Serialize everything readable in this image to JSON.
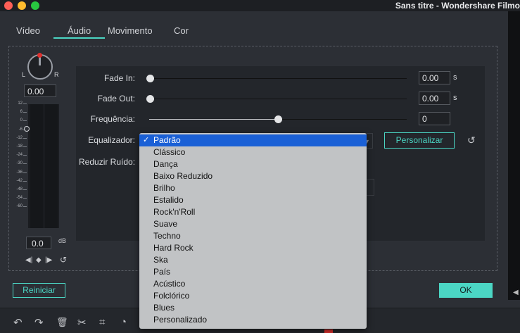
{
  "window": {
    "title": "Sans titre - Wondershare Filmo"
  },
  "tabs": [
    {
      "label": "Vídeo"
    },
    {
      "label": "Áudio"
    },
    {
      "label": "Movimento"
    },
    {
      "label": "Cor"
    }
  ],
  "active_tab": "Áudio",
  "pan": {
    "left_label": "L",
    "right_label": "R",
    "value": "0.00"
  },
  "meter": {
    "scale": [
      "12",
      "6",
      "0",
      "-6",
      "-12",
      "-18",
      "-24",
      "-30",
      "-36",
      "-42",
      "-48",
      "-54",
      "-60"
    ],
    "db_value": "0.0",
    "db_unit": "dB"
  },
  "settings": {
    "fade_in": {
      "label": "Fade In:",
      "value": "0.00",
      "unit": "s"
    },
    "fade_out": {
      "label": "Fade Out:",
      "value": "0.00",
      "unit": "s"
    },
    "frequency": {
      "label": "Frequência:",
      "value": "0",
      "slider_fraction": 0.5
    },
    "equalizer": {
      "label": "Equalizador:",
      "customize_label": "Personalizar"
    },
    "noise": {
      "label": "Reduzir Ruído:"
    }
  },
  "dropdown": {
    "selected": "Padrão",
    "options": [
      "Padrão",
      "Clássico",
      "Dança",
      "Baixo Reduzido",
      "Brilho",
      "Estalido",
      "Rock'n'Roll",
      "Suave",
      "Techno",
      "Hard Rock",
      "Ska",
      "País",
      "Acústico",
      "Folclórico",
      "Blues",
      "Personalizado"
    ]
  },
  "footer": {
    "reset_label": "Reiniciar",
    "ok_label": "OK"
  },
  "toolbar": {
    "icons": [
      "undo-icon",
      "redo-icon",
      "trash-icon",
      "scissors-icon",
      "crop-icon",
      "speed-icon"
    ]
  },
  "colors": {
    "accent": "#4bd6c4",
    "selection": "#1a60d6",
    "background": "#2c2f35"
  }
}
